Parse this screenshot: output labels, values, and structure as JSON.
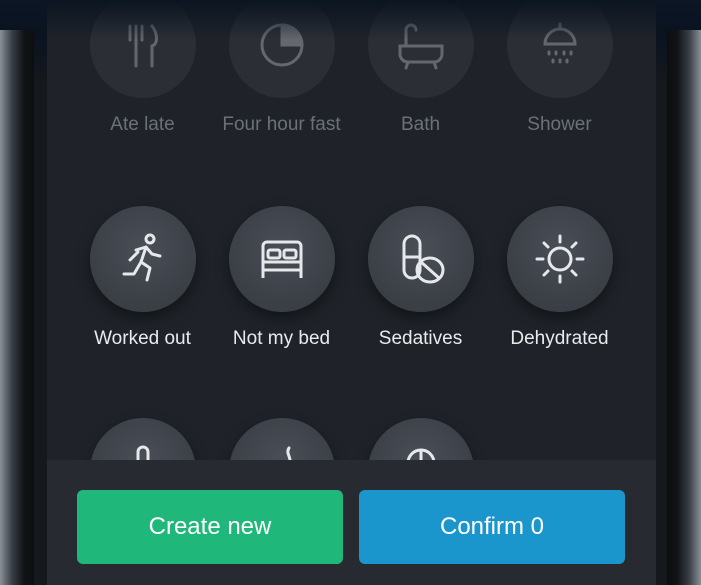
{
  "rows": [
    {
      "faded": true,
      "items": [
        {
          "label": "Ate late",
          "icon": "fork-knife-icon"
        },
        {
          "label": "Four hour fast",
          "icon": "clock-fast-icon"
        },
        {
          "label": "Bath",
          "icon": "bathtub-icon"
        },
        {
          "label": "Shower",
          "icon": "shower-icon"
        }
      ]
    },
    {
      "faded": false,
      "items": [
        {
          "label": "Worked out",
          "icon": "running-icon"
        },
        {
          "label": "Not my bed",
          "icon": "bed-icon"
        },
        {
          "label": "Sedatives",
          "icon": "pills-icon"
        },
        {
          "label": "Dehydrated",
          "icon": "sun-icon"
        }
      ]
    },
    {
      "faded": false,
      "items": [
        {
          "label": "",
          "icon": "thermometer-icon"
        },
        {
          "label": "",
          "icon": "hot-drink-icon"
        },
        {
          "label": "",
          "icon": "mouse-icon"
        }
      ]
    }
  ],
  "actions": {
    "create_label": "Create new",
    "confirm_label": "Confirm 0"
  },
  "colors": {
    "create": "#1fb87a",
    "confirm": "#1a96cc",
    "tile": "#3c4148",
    "background": "#1f2329"
  }
}
